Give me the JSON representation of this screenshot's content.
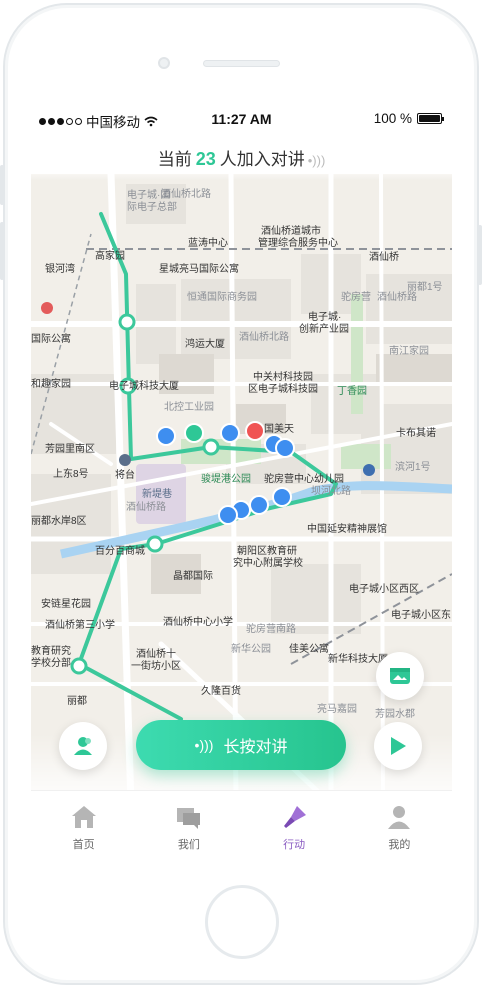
{
  "status_bar": {
    "carrier": "中国移动",
    "time": "11:27 AM",
    "battery": "100 %"
  },
  "talk_header": {
    "prefix": "当前",
    "count": "23",
    "suffix": "人加入对讲"
  },
  "map": {
    "labels": {
      "l1": "电子城·国",
      "l2": "际电子总部",
      "l3": "酒仙桥道城市",
      "l4": "管理综合服务中心",
      "l5": "高家园",
      "l6": "蓝涛中心",
      "l7": "酒仙桥",
      "l8": "银河湾",
      "l9": "星城亮马国际公寓",
      "l10": "恒通国际商务园",
      "l11": "电子城·",
      "l12": "创新产业园",
      "l13": "酒仙桥北路",
      "l14": "国际公寓",
      "l15": "鸿运大厦",
      "l16": "中关村科技园",
      "l17": "区电子城科技园",
      "l18": "和趣家园",
      "l19": "电子城科技大厦",
      "l20": "北控工业园",
      "l21": "丁香园",
      "l22": "国美天",
      "l23": "卡布其诺",
      "l24": "芳园里南区",
      "l25": "将台",
      "l26": "上东8号",
      "l27": "酒仙桥路",
      "l28": "新堤巷",
      "l29": "驼房营中心幼儿园",
      "l30": "坝河北路",
      "l31": "丽都水岸8区",
      "l32": "中国延安精神展馆",
      "l33": "百分百商城",
      "l34": "朝阳区教育研",
      "l35": "究中心附属学校",
      "l36": "晶都国际",
      "l37": "电子城小区西区",
      "l38": "安链星花园",
      "l39": "电子城小区东",
      "l40": "酒仙桥第三小学",
      "l41": "酒仙桥中心小学",
      "l42": "佳美公寓",
      "l43": "新华科技大厦",
      "l44": "教育研究",
      "l45": "学校分部",
      "l46": "酒仙桥十",
      "l47": "一街坊小区",
      "l48": "久隆百货",
      "l49": "丽都",
      "l50": "亮马嘉园",
      "l51": "芳园水郡",
      "l52": "驼房营",
      "l53": "酒仙桥路",
      "l54": "南江家园",
      "l55": "滨河1号",
      "l56": "丽都1号",
      "l57": "新华公园",
      "l58": "酒仙桥北路",
      "l59": "驼房营南路"
    },
    "park_label": "骏堤港公园",
    "compass_label": "将"
  },
  "actions": {
    "ptt_label": "长按对讲"
  },
  "tabbar": {
    "home": "首页",
    "mine_group": "我们",
    "action": "行动",
    "me": "我的"
  },
  "colors": {
    "accent": "#2ec796",
    "route": "#3cc89b",
    "active_tab": "#8a5bc2",
    "marker_blue": "#3e8ef0",
    "marker_red": "#f05454",
    "marker_green": "#2ec796"
  },
  "icons": {
    "back": "chevron-left-icon",
    "gallery": "gallery-icon",
    "play": "play-icon",
    "contacts": "contacts-icon"
  }
}
